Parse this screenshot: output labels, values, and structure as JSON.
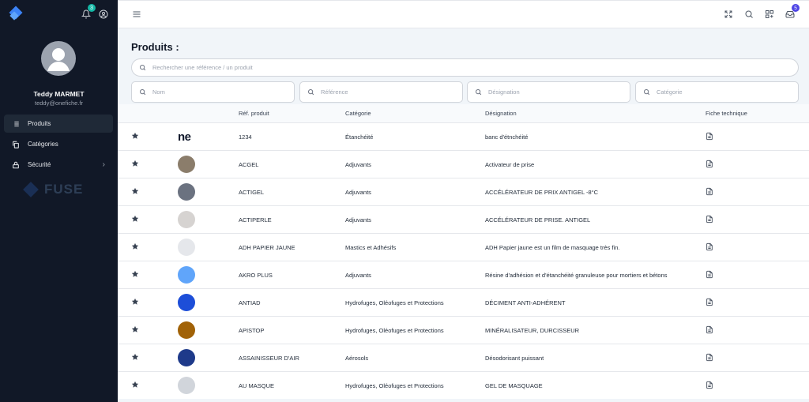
{
  "user": {
    "name": "Teddy MARMET",
    "email": "teddy@onefiche.fr"
  },
  "notifications": {
    "count": "3"
  },
  "messages": {
    "count": "5"
  },
  "nav": [
    {
      "label": "Produits",
      "icon": "list-icon",
      "active": true
    },
    {
      "label": "Catégories",
      "icon": "copy-icon"
    },
    {
      "label": "Sécurité",
      "icon": "lock-icon",
      "expandable": true
    }
  ],
  "brand": {
    "watermark": "FUSE"
  },
  "page": {
    "title": "Produits :"
  },
  "search": {
    "placeholder": "Rechercher une référence / un produit"
  },
  "filters": [
    {
      "placeholder": "Nom"
    },
    {
      "placeholder": "Référence"
    },
    {
      "placeholder": "Désignation"
    },
    {
      "placeholder": "Catégorie"
    }
  ],
  "table": {
    "headers": {
      "ref": "Réf. produit",
      "cat": "Catégorie",
      "des": "Désignation",
      "fiche": "Fiche technique"
    },
    "rows": [
      {
        "logo_text": "ne",
        "thumb": "#ffffff",
        "ref": "1234",
        "cat": "Étanchéité",
        "des": "banc d'étnchéité"
      },
      {
        "thumb": "#8b7d6b",
        "ref": "ACGEL",
        "cat": "Adjuvants",
        "des": "Activateur de prise"
      },
      {
        "thumb": "#6b7280",
        "ref": "ACTIGEL",
        "cat": "Adjuvants",
        "des": "ACCÉLÉRATEUR DE PRIX ANTIGEL -8°C"
      },
      {
        "thumb": "#d6d3d1",
        "ref": "ACTIPERLE",
        "cat": "Adjuvants",
        "des": "ACCÉLÉRATEUR DE PRISE. ANTIGEL"
      },
      {
        "thumb": "#e5e7eb",
        "ref": "ADH PAPIER JAUNE",
        "cat": "Mastics et Adhésifs",
        "des": "ADH Papier jaune est un film de masquage très fin."
      },
      {
        "thumb": "#60a5fa",
        "ref": "AKRO PLUS",
        "cat": "Adjuvants",
        "des": "Résine d'adhésion et d'étanchéité granuleuse pour mortiers et bétons"
      },
      {
        "thumb": "#1d4ed8",
        "ref": "ANTIAD",
        "cat": "Hydrofuges, Oléofuges et Protections",
        "des": "DÉCIMENT ANTI-ADHÉRENT"
      },
      {
        "thumb": "#a16207",
        "ref": "APISTOP",
        "cat": "Hydrofuges, Oléofuges et Protections",
        "des": "MINÉRALISATEUR, DURCISSEUR"
      },
      {
        "thumb": "#1e3a8a",
        "ref": "ASSAINISSEUR D'AIR",
        "cat": "Aérosols",
        "des": "Désodorisant puissant"
      },
      {
        "thumb": "#d1d5db",
        "ref": "AU MASQUE",
        "cat": "Hydrofuges, Oléofuges et Protections",
        "des": "GEL DE MASQUAGE"
      }
    ]
  }
}
